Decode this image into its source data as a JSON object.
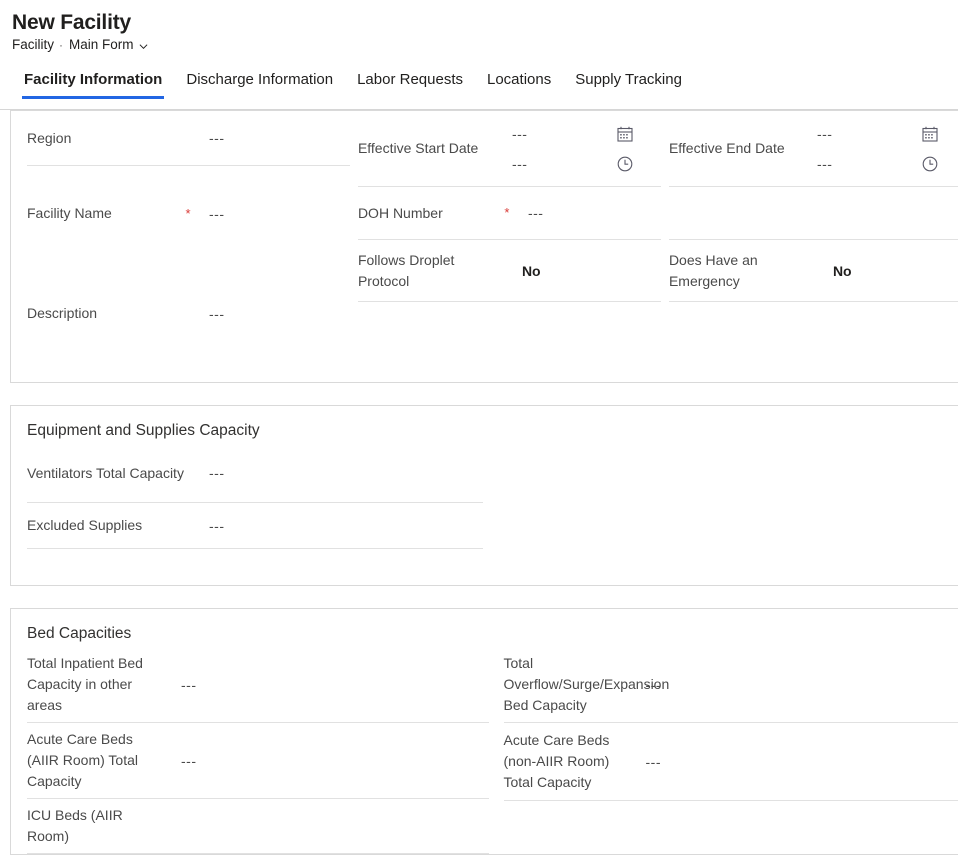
{
  "header": {
    "title": "New Facility",
    "entity": "Facility",
    "separator": "·",
    "form_name": "Main Form",
    "chevron_icon": "chevron-down-icon"
  },
  "tabs": [
    {
      "label": "Facility Information",
      "active": true
    },
    {
      "label": "Discharge Information",
      "active": false
    },
    {
      "label": "Labor Requests",
      "active": false
    },
    {
      "label": "Locations",
      "active": false
    },
    {
      "label": "Supply Tracking",
      "active": false
    }
  ],
  "empty_value": "---",
  "icons": {
    "calendar": "calendar-icon",
    "clock": "clock-icon"
  },
  "sections": [
    {
      "id": "facility-information",
      "title": "",
      "left_fields": [
        {
          "label": "Region",
          "value": "---",
          "required": false
        },
        {
          "label": "",
          "value": "",
          "blank": true
        },
        {
          "label": "Facility Name",
          "value": "---",
          "required": true
        },
        {
          "label": "",
          "value": "",
          "blank": true
        },
        {
          "label": "Description",
          "value": "---",
          "required": false
        }
      ],
      "mid_fields": [
        {
          "label": "Effective Start Date",
          "type": "datetime",
          "date_value": "---",
          "time_value": "---"
        },
        {
          "label": "DOH Number",
          "value": "---",
          "required": true
        },
        {
          "label": "Follows Droplet Protocol",
          "value": "No",
          "bold": true
        }
      ],
      "right_fields": [
        {
          "label": "Effective End Date",
          "type": "datetime",
          "date_value": "---",
          "time_value": "---"
        },
        {
          "label": "Does Have an Emergency",
          "value": "No",
          "bold": true
        }
      ]
    },
    {
      "id": "equipment-and-supplies-capacity",
      "title": "Equipment and Supplies Capacity",
      "left_fields": [
        {
          "label": "Ventilators Total Capacity",
          "value": "---"
        },
        {
          "label": "Excluded Supplies",
          "value": "---"
        }
      ],
      "right_fields": []
    },
    {
      "id": "bed-capacities",
      "title": "Bed Capacities",
      "left_fields": [
        {
          "label": "Total Inpatient Bed Capacity in other areas",
          "value": "---"
        },
        {
          "label": "Acute Care Beds (AIIR Room) Total Capacity",
          "value": "---"
        },
        {
          "label": "ICU Beds (AIIR Room)",
          "value": ""
        }
      ],
      "right_fields": [
        {
          "label": "Total Overflow/Surge/Expansion Bed Capacity",
          "value": "---"
        },
        {
          "label": "Acute Care Beds (non-AIIR Room) Total Capacity",
          "value": "---"
        }
      ]
    }
  ],
  "colors": {
    "accent": "#2266e3",
    "required": "#d93a36",
    "label": "#4a4a4a",
    "rule": "#e1e1e1",
    "card_border": "#d9d9d9"
  }
}
